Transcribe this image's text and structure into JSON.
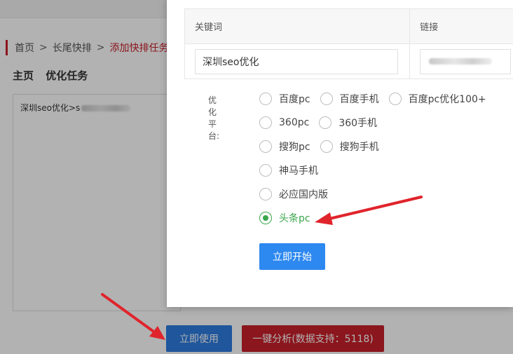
{
  "breadcrumb": {
    "home": "首页",
    "sep1": ">",
    "level2": "长尾快排",
    "sep2": ">",
    "current": "添加快排任务"
  },
  "page_title": {
    "main": "主页",
    "sub": "优化任务"
  },
  "task_box": {
    "text": "深圳seo优化>s"
  },
  "bottom_buttons": {
    "use_now": "立即使用",
    "analyze": "一键分析(数据支持：5118)"
  },
  "modal": {
    "columns": {
      "keyword": "关键词",
      "link": "链接"
    },
    "row": {
      "keyword": "深圳seo优化",
      "link": ""
    },
    "platform_label": "优化平台:",
    "platforms": [
      [
        "百度pc",
        "百度手机",
        "百度pc优化100+"
      ],
      [
        "360pc",
        "360手机"
      ],
      [
        "搜狗pc",
        "搜狗手机"
      ],
      [
        "神马手机"
      ],
      [
        "必应国内版"
      ],
      [
        "头条pc"
      ]
    ],
    "selected_platform": "头条pc",
    "start_button": "立即开始"
  },
  "colors": {
    "accent_red": "#c8202a",
    "primary_blue": "#2d7be0",
    "selected_green": "#3aa64b",
    "arrow_red": "#e0242c"
  }
}
